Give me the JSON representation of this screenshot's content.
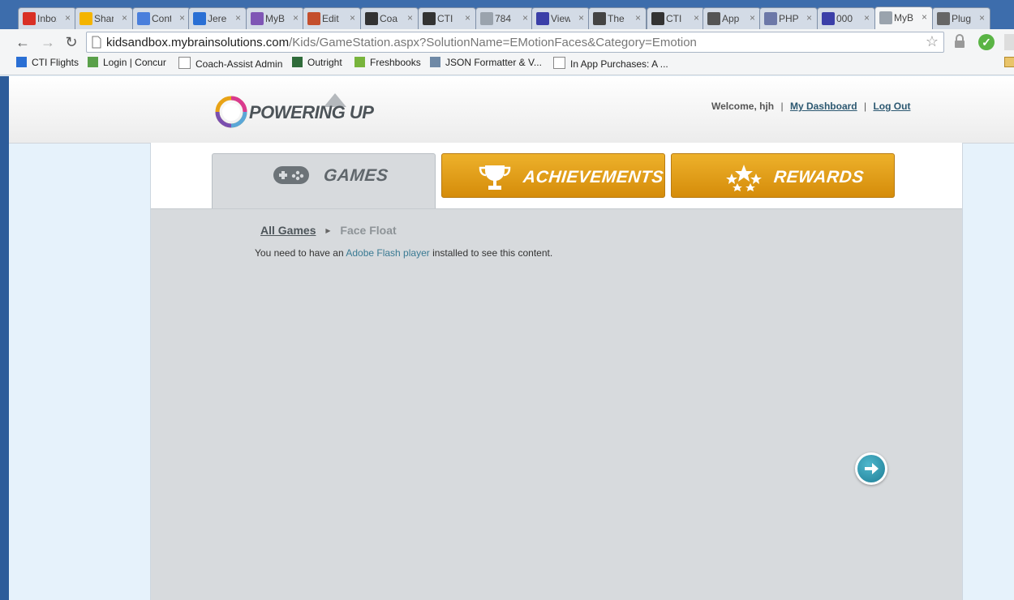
{
  "browser": {
    "tabs": [
      {
        "label": "Inbox",
        "icon": "gmail-icon",
        "color": "#d93025"
      },
      {
        "label": "Shared",
        "icon": "drive-icon",
        "color": "#f4b400"
      },
      {
        "label": "Cont",
        "icon": "docs-icon",
        "color": "#4a7fdc"
      },
      {
        "label": "Jere",
        "icon": "calendar-icon",
        "color": "#2a6fd4"
      },
      {
        "label": "MyB",
        "icon": "mybrain-icon",
        "color": "#7f56b5"
      },
      {
        "label": "Edit",
        "icon": "tc-icon",
        "color": "#c44f2d"
      },
      {
        "label": "Coa",
        "icon": "github-icon",
        "color": "#333333"
      },
      {
        "label": "CTI",
        "icon": "cti-icon",
        "color": "#333333"
      },
      {
        "label": "784",
        "icon": "page-icon",
        "color": "#9aa3ad"
      },
      {
        "label": "View",
        "icon": "m-icon",
        "color": "#3b3fa8"
      },
      {
        "label": "The",
        "icon": "chart-icon",
        "color": "#444444"
      },
      {
        "label": "CTI",
        "icon": "cti-icon",
        "color": "#333333"
      },
      {
        "label": "App",
        "icon": "apple-icon",
        "color": "#555555"
      },
      {
        "label": "PHP",
        "icon": "php-icon",
        "color": "#6c78a8"
      },
      {
        "label": "000",
        "icon": "m-icon",
        "color": "#3b3fa8"
      },
      {
        "label": "MyB",
        "icon": "page-icon",
        "color": "#9aa3ad"
      },
      {
        "label": "Plug",
        "icon": "puzzle-icon",
        "color": "#666666"
      }
    ],
    "url_domain": "kidsandbox.mybrainsolutions.com",
    "url_path": "/Kids/GameStation.aspx?SolutionName=EMotionFaces&Category=Emotion",
    "bookmarks": [
      "CTI Flights",
      "Login | Concur",
      "Coach-Assist Admin",
      "Outright",
      "Freshbooks",
      "JSON Formatter & V...",
      "In App Purchases: A ..."
    ]
  },
  "header": {
    "logo_text": "POWERING UP",
    "welcome": "Welcome, hjh",
    "sep": "|",
    "dashboard_link": "My Dashboard",
    "logout_link": "Log Out"
  },
  "nav": {
    "games": "GAMES",
    "achievements": "ACHIEVEMENTS",
    "rewards": "REWARDS"
  },
  "breadcrumb": {
    "root": "All Games",
    "current": "Face Float"
  },
  "flash_message": {
    "before": "You need to have an ",
    "link": "Adobe Flash player",
    "after": " installed to see this content."
  },
  "colors": {
    "accent_gold": "#e8a317",
    "link": "#2c5871",
    "next_button": "#2a8fa7"
  }
}
